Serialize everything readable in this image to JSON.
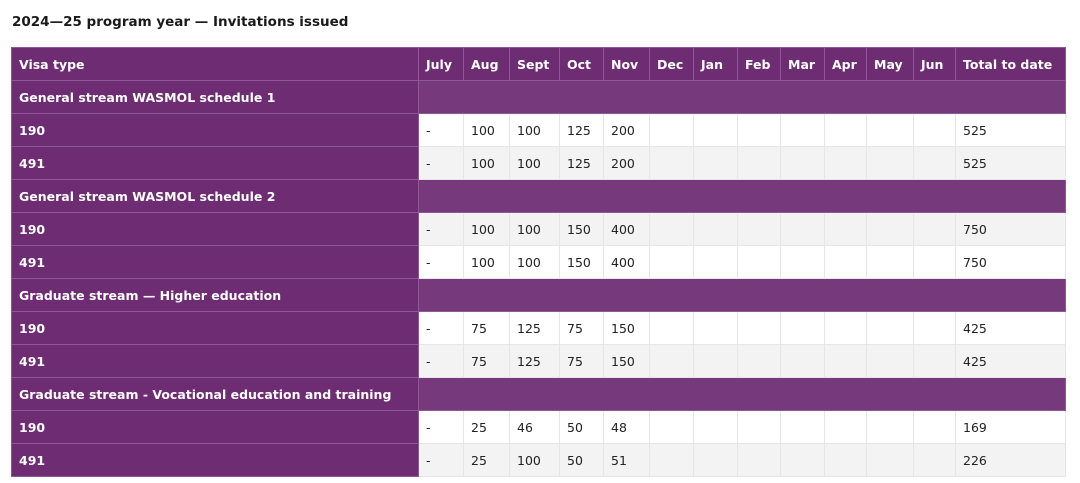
{
  "heading": "2024—25 program year — Invitations issued",
  "columns": [
    "Visa type",
    "July",
    "Aug",
    "Sept",
    "Oct",
    "Nov",
    "Dec",
    "Jan",
    "Feb",
    "Mar",
    "Apr",
    "May",
    "Jun",
    "Total to date"
  ],
  "sections": [
    {
      "title": "General stream WASMOL schedule 1",
      "rows": [
        {
          "visa": "190",
          "values": [
            "-",
            "100",
            "100",
            "125",
            "200",
            "",
            "",
            "",
            "",
            "",
            "",
            ""
          ],
          "total": "525"
        },
        {
          "visa": "491",
          "values": [
            "-",
            "100",
            "100",
            "125",
            "200",
            "",
            "",
            "",
            "",
            "",
            "",
            ""
          ],
          "total": "525"
        }
      ]
    },
    {
      "title": "General stream WASMOL schedule 2",
      "rows": [
        {
          "visa": "190",
          "values": [
            "-",
            "100",
            "100",
            "150",
            "400",
            "",
            "",
            "",
            "",
            "",
            "",
            ""
          ],
          "total": "750"
        },
        {
          "visa": "491",
          "values": [
            "-",
            "100",
            "100",
            "150",
            "400",
            "",
            "",
            "",
            "",
            "",
            "",
            ""
          ],
          "total": "750"
        }
      ]
    },
    {
      "title": "Graduate stream — Higher education",
      "rows": [
        {
          "visa": "190",
          "values": [
            "-",
            "75",
            "125",
            "75",
            "150",
            "",
            "",
            "",
            "",
            "",
            "",
            ""
          ],
          "total": "425"
        },
        {
          "visa": "491",
          "values": [
            "-",
            "75",
            "125",
            "75",
            "150",
            "",
            "",
            "",
            "",
            "",
            "",
            ""
          ],
          "total": "425"
        }
      ]
    },
    {
      "title": "Graduate stream - Vocational education and training",
      "rows": [
        {
          "visa": "190",
          "values": [
            "-",
            "25",
            "46",
            "50",
            "48",
            "",
            "",
            "",
            "",
            "",
            "",
            ""
          ],
          "total": "169"
        },
        {
          "visa": "491",
          "values": [
            "-",
            "25",
            "100",
            "50",
            "51",
            "",
            "",
            "",
            "",
            "",
            "",
            ""
          ],
          "total": "226"
        }
      ]
    }
  ]
}
